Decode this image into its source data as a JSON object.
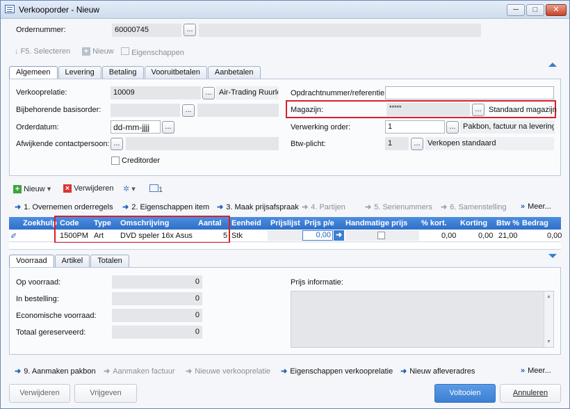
{
  "window": {
    "title": "Verkooporder - Nieuw",
    "min": "─",
    "max": "□",
    "close": "✕"
  },
  "header": {
    "ordernummer_label": "Ordernummer:",
    "ordernummer_value": "60000745",
    "dots": "..."
  },
  "toolbar": {
    "select": "F5. Selecteren",
    "new": "Nieuw",
    "props": "Eigenschappen"
  },
  "tabs": [
    "Algemeen",
    "Levering",
    "Betaling",
    "Vooruitbetalen",
    "Aanbetalen"
  ],
  "general": {
    "verkooprelatie_label": "Verkooprelatie:",
    "verkooprelatie_value": "10009",
    "verkooprelatie_name": "Air-Trading Ruurlo",
    "basisorder_label": "Bijbehorende basisorder:",
    "orderdatum_label": "Orderdatum:",
    "orderdatum_value": "dd-mm-jjjj",
    "contact_label": "Afwijkende contactpersoon:",
    "creditorder_label": "Creditorder",
    "opdracht_label": "Opdrachtnummer/referentie:",
    "magazijn_label": "Magazijn:",
    "magazijn_value": "*****",
    "magazijn_name": "Standaard magazijn",
    "verwerking_label": "Verwerking order:",
    "verwerking_value": "1",
    "verwerking_name": "Pakbon, factuur na levering",
    "btw_label": "Btw-plicht:",
    "btw_value": "1",
    "btw_name": "Verkopen standaard"
  },
  "lines_toolbar": {
    "new": "Nieuw",
    "delete": "Verwijderen",
    "count": "1"
  },
  "steps": [
    "1. Overnemen orderregels",
    "2. Eigenschappen item",
    "3. Maak prijsafspraak",
    "4. Partijen",
    "5. Serienummers",
    "6. Samenstelling",
    "Meer..."
  ],
  "grid": {
    "columns": [
      "Zoekhulp",
      "Code",
      "Type",
      "Omschrijving",
      "Aantal",
      "Eenheid",
      "Prijslijst",
      "Prijs p/e",
      "Handmatige prijs",
      "% kort.",
      "Korting",
      "Btw %",
      "Bedrag"
    ],
    "row": {
      "code": "1500PM",
      "type": "Art",
      "omschrijving": "DVD speler 16x Asus",
      "aantal": "5",
      "eenheid": "Stk",
      "prijs": "0,00",
      "kort": "0,00",
      "korting": "0,00",
      "btw": "21,00",
      "bedrag": "0,00"
    }
  },
  "tabs2": [
    "Voorraad",
    "Artikel",
    "Totalen"
  ],
  "stock": {
    "op_voorraad_label": "Op voorraad:",
    "op_voorraad": "0",
    "in_bestelling_label": "In bestelling:",
    "in_bestelling": "0",
    "economisch_label": "Economische voorraad:",
    "economisch": "0",
    "totaal_label": "Totaal gereserveerd:",
    "totaal": "0",
    "prijs_info_label": "Prijs informatie:"
  },
  "actions": [
    "9. Aanmaken pakbon",
    "Aanmaken factuur",
    "Nieuwe verkooprelatie",
    "Eigenschappen verkooprelatie",
    "Nieuw afleveradres",
    "Meer..."
  ],
  "buttons": {
    "delete": "Verwijderen",
    "release": "Vrijgeven",
    "finish": "Voltooien",
    "cancel": "Annuleren"
  },
  "colors": {
    "accent": "#2f6fc9",
    "highlight": "#d8202a"
  }
}
